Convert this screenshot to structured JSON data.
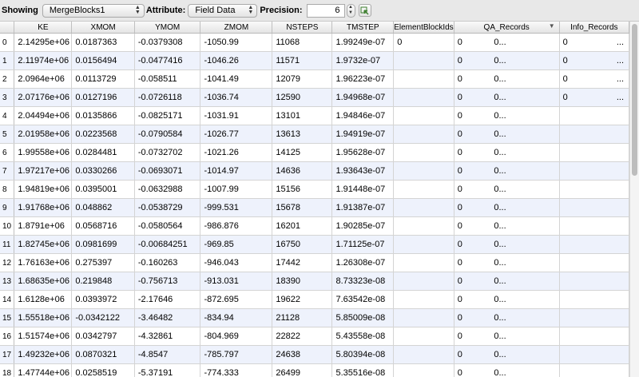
{
  "toolbar": {
    "showing_label": "Showing",
    "source_value": "MergeBlocks1",
    "attribute_label": "Attribute:",
    "attribute_value": "Field Data",
    "precision_label": "Precision:",
    "precision_value": "6",
    "toggle_icon": "select-cells-icon"
  },
  "table": {
    "columns": [
      "KE",
      "XMOM",
      "YMOM",
      "ZMOM",
      "NSTEPS",
      "TMSTEP",
      "ElementBlockIds",
      "QA_Records",
      "Info_Records"
    ],
    "sorted_column": "QA_Records",
    "rows": [
      {
        "id": "0",
        "ke": "2.14295e+06",
        "xmom": "0.0187363",
        "ymom": "-0.0379308",
        "zmom": "-1050.99",
        "nsteps": "11068",
        "tmstep": "1.99249e-07",
        "ebid": "0",
        "qa": "0",
        "qa_more": "0...",
        "info": "0",
        "info_more": "..."
      },
      {
        "id": "1",
        "ke": "2.11974e+06",
        "xmom": "0.0156494",
        "ymom": "-0.0477416",
        "zmom": "-1046.26",
        "nsteps": "11571",
        "tmstep": "1.9732e-07",
        "ebid": "",
        "qa": "0",
        "qa_more": "0...",
        "info": "0",
        "info_more": "..."
      },
      {
        "id": "2",
        "ke": "2.0964e+06",
        "xmom": "0.0113729",
        "ymom": "-0.058511",
        "zmom": "-1041.49",
        "nsteps": "12079",
        "tmstep": "1.96223e-07",
        "ebid": "",
        "qa": "0",
        "qa_more": "0...",
        "info": "0",
        "info_more": "..."
      },
      {
        "id": "3",
        "ke": "2.07176e+06",
        "xmom": "0.0127196",
        "ymom": "-0.0726118",
        "zmom": "-1036.74",
        "nsteps": "12590",
        "tmstep": "1.94968e-07",
        "ebid": "",
        "qa": "0",
        "qa_more": "0...",
        "info": "0",
        "info_more": "..."
      },
      {
        "id": "4",
        "ke": "2.04494e+06",
        "xmom": "0.0135866",
        "ymom": "-0.0825171",
        "zmom": "-1031.91",
        "nsteps": "13101",
        "tmstep": "1.94846e-07",
        "ebid": "",
        "qa": "0",
        "qa_more": "0...",
        "info": "",
        "info_more": ""
      },
      {
        "id": "5",
        "ke": "2.01958e+06",
        "xmom": "0.0223568",
        "ymom": "-0.0790584",
        "zmom": "-1026.77",
        "nsteps": "13613",
        "tmstep": "1.94919e-07",
        "ebid": "",
        "qa": "0",
        "qa_more": "0...",
        "info": "",
        "info_more": ""
      },
      {
        "id": "6",
        "ke": "1.99558e+06",
        "xmom": "0.0284481",
        "ymom": "-0.0732702",
        "zmom": "-1021.26",
        "nsteps": "14125",
        "tmstep": "1.95628e-07",
        "ebid": "",
        "qa": "0",
        "qa_more": "0...",
        "info": "",
        "info_more": ""
      },
      {
        "id": "7",
        "ke": "1.97217e+06",
        "xmom": "0.0330266",
        "ymom": "-0.0693071",
        "zmom": "-1014.97",
        "nsteps": "14636",
        "tmstep": "1.93643e-07",
        "ebid": "",
        "qa": "0",
        "qa_more": "0...",
        "info": "",
        "info_more": ""
      },
      {
        "id": "8",
        "ke": "1.94819e+06",
        "xmom": "0.0395001",
        "ymom": "-0.0632988",
        "zmom": "-1007.99",
        "nsteps": "15156",
        "tmstep": "1.91448e-07",
        "ebid": "",
        "qa": "0",
        "qa_more": "0...",
        "info": "",
        "info_more": ""
      },
      {
        "id": "9",
        "ke": "1.91768e+06",
        "xmom": "0.048862",
        "ymom": "-0.0538729",
        "zmom": "-999.531",
        "nsteps": "15678",
        "tmstep": "1.91387e-07",
        "ebid": "",
        "qa": "0",
        "qa_more": "0...",
        "info": "",
        "info_more": ""
      },
      {
        "id": "10",
        "ke": "1.8791e+06",
        "xmom": "0.0568716",
        "ymom": "-0.0580564",
        "zmom": "-986.876",
        "nsteps": "16201",
        "tmstep": "1.90285e-07",
        "ebid": "",
        "qa": "0",
        "qa_more": "0...",
        "info": "",
        "info_more": ""
      },
      {
        "id": "11",
        "ke": "1.82745e+06",
        "xmom": "0.0981699",
        "ymom": "-0.00684251",
        "zmom": "-969.85",
        "nsteps": "16750",
        "tmstep": "1.71125e-07",
        "ebid": "",
        "qa": "0",
        "qa_more": "0...",
        "info": "",
        "info_more": ""
      },
      {
        "id": "12",
        "ke": "1.76163e+06",
        "xmom": "0.275397",
        "ymom": "-0.160263",
        "zmom": "-946.043",
        "nsteps": "17442",
        "tmstep": "1.26308e-07",
        "ebid": "",
        "qa": "0",
        "qa_more": "0...",
        "info": "",
        "info_more": ""
      },
      {
        "id": "13",
        "ke": "1.68635e+06",
        "xmom": "0.219848",
        "ymom": "-0.756713",
        "zmom": "-913.031",
        "nsteps": "18390",
        "tmstep": "8.73323e-08",
        "ebid": "",
        "qa": "0",
        "qa_more": "0...",
        "info": "",
        "info_more": ""
      },
      {
        "id": "14",
        "ke": "1.6128e+06",
        "xmom": "0.0393972",
        "ymom": "-2.17646",
        "zmom": "-872.695",
        "nsteps": "19622",
        "tmstep": "7.63542e-08",
        "ebid": "",
        "qa": "0",
        "qa_more": "0...",
        "info": "",
        "info_more": ""
      },
      {
        "id": "15",
        "ke": "1.55518e+06",
        "xmom": "-0.0342122",
        "ymom": "-3.46482",
        "zmom": "-834.94",
        "nsteps": "21128",
        "tmstep": "5.85009e-08",
        "ebid": "",
        "qa": "0",
        "qa_more": "0...",
        "info": "",
        "info_more": ""
      },
      {
        "id": "16",
        "ke": "1.51574e+06",
        "xmom": "0.0342797",
        "ymom": "-4.32861",
        "zmom": "-804.969",
        "nsteps": "22822",
        "tmstep": "5.43558e-08",
        "ebid": "",
        "qa": "0",
        "qa_more": "0...",
        "info": "",
        "info_more": ""
      },
      {
        "id": "17",
        "ke": "1.49232e+06",
        "xmom": "0.0870321",
        "ymom": "-4.8547",
        "zmom": "-785.797",
        "nsteps": "24638",
        "tmstep": "5.80394e-08",
        "ebid": "",
        "qa": "0",
        "qa_more": "0...",
        "info": "",
        "info_more": ""
      },
      {
        "id": "18",
        "ke": "1.47744e+06",
        "xmom": "0.0258519",
        "ymom": "-5.37191",
        "zmom": "-774.333",
        "nsteps": "26499",
        "tmstep": "5.35516e-08",
        "ebid": "",
        "qa": "0",
        "qa_more": "0...",
        "info": "",
        "info_more": ""
      }
    ]
  },
  "colors": {
    "alt_row": "#eef2fc",
    "grid_line": "#d4d4d4"
  }
}
